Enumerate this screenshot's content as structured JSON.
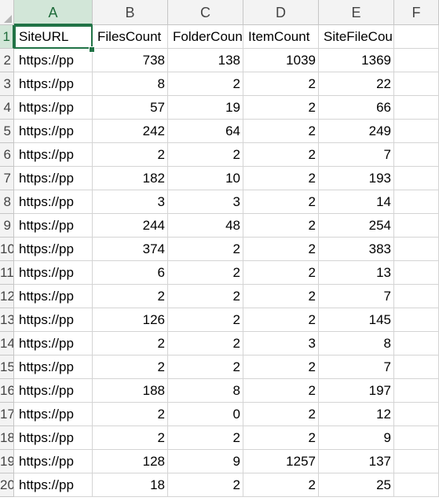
{
  "columns": [
    "A",
    "B",
    "C",
    "D",
    "E",
    "F"
  ],
  "rows": [
    {
      "n": "1",
      "cells": [
        "SiteURL",
        "FilesCount",
        "FolderCount",
        "ItemCount",
        "SiteFileCount",
        ""
      ]
    },
    {
      "n": "2",
      "cells": [
        "https://pp",
        "738",
        "138",
        "1039",
        "1369",
        ""
      ]
    },
    {
      "n": "3",
      "cells": [
        "https://pp",
        "8",
        "2",
        "2",
        "22",
        ""
      ]
    },
    {
      "n": "4",
      "cells": [
        "https://pp",
        "57",
        "19",
        "2",
        "66",
        ""
      ]
    },
    {
      "n": "5",
      "cells": [
        "https://pp",
        "242",
        "64",
        "2",
        "249",
        ""
      ]
    },
    {
      "n": "6",
      "cells": [
        "https://pp",
        "2",
        "2",
        "2",
        "7",
        ""
      ]
    },
    {
      "n": "7",
      "cells": [
        "https://pp",
        "182",
        "10",
        "2",
        "193",
        ""
      ]
    },
    {
      "n": "8",
      "cells": [
        "https://pp",
        "3",
        "3",
        "2",
        "14",
        ""
      ]
    },
    {
      "n": "9",
      "cells": [
        "https://pp",
        "244",
        "48",
        "2",
        "254",
        ""
      ]
    },
    {
      "n": "10",
      "cells": [
        "https://pp",
        "374",
        "2",
        "2",
        "383",
        ""
      ]
    },
    {
      "n": "11",
      "cells": [
        "https://pp",
        "6",
        "2",
        "2",
        "13",
        ""
      ]
    },
    {
      "n": "12",
      "cells": [
        "https://pp",
        "2",
        "2",
        "2",
        "7",
        ""
      ]
    },
    {
      "n": "13",
      "cells": [
        "https://pp",
        "126",
        "2",
        "2",
        "145",
        ""
      ]
    },
    {
      "n": "14",
      "cells": [
        "https://pp",
        "2",
        "2",
        "3",
        "8",
        ""
      ]
    },
    {
      "n": "15",
      "cells": [
        "https://pp",
        "2",
        "2",
        "2",
        "7",
        ""
      ]
    },
    {
      "n": "16",
      "cells": [
        "https://pp",
        "188",
        "8",
        "2",
        "197",
        ""
      ]
    },
    {
      "n": "17",
      "cells": [
        "https://pp",
        "2",
        "0",
        "2",
        "12",
        ""
      ]
    },
    {
      "n": "18",
      "cells": [
        "https://pp",
        "2",
        "2",
        "2",
        "9",
        ""
      ]
    },
    {
      "n": "19",
      "cells": [
        "https://pp",
        "128",
        "9",
        "1257",
        "137",
        ""
      ]
    },
    {
      "n": "20",
      "cells": [
        "https://pp",
        "18",
        "2",
        "2",
        "25",
        ""
      ]
    }
  ],
  "selection": {
    "column": "A",
    "row": "1"
  },
  "colors": {
    "accent": "#217346",
    "header_bg": "#f3f3f3",
    "active_header_bg": "#d2e6d8",
    "gridline": "#d4d4d4"
  }
}
